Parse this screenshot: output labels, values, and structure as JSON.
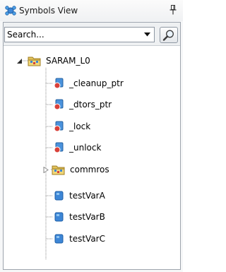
{
  "panel": {
    "title": "Symbols View",
    "title_icon": "symbols-view-icon",
    "pin_icon": "pin-icon"
  },
  "search": {
    "placeholder": "Search...",
    "value": "",
    "button_icon": "magnifier-icon"
  },
  "tree": {
    "root": {
      "label": "SARAM_L0",
      "expanded": true,
      "icon": "folder-icon",
      "children": [
        {
          "label": "_cleanup_ptr",
          "icon": "function-symbol-icon"
        },
        {
          "label": "_dtors_ptr",
          "icon": "function-symbol-icon"
        },
        {
          "label": "_lock",
          "icon": "function-symbol-icon"
        },
        {
          "label": "_unlock",
          "icon": "function-symbol-icon"
        },
        {
          "label": "commros",
          "icon": "folder-icon",
          "expanded": false
        },
        {
          "label": "testVarA",
          "icon": "variable-symbol-icon"
        },
        {
          "label": "testVarB",
          "icon": "variable-symbol-icon"
        },
        {
          "label": "testVarC",
          "icon": "variable-symbol-icon"
        }
      ]
    }
  },
  "colors": {
    "accent": "#2a6ebd",
    "symbol_red": "#d9413a",
    "folder": "#d6b24a"
  }
}
